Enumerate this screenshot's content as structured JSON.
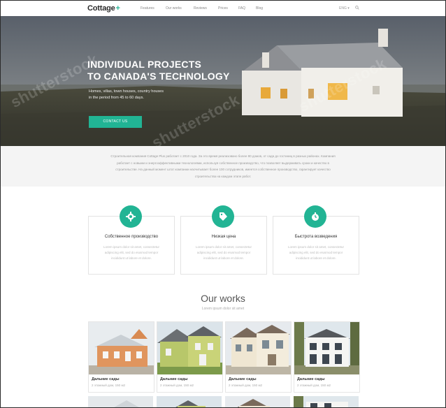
{
  "header": {
    "logo": "Cottage",
    "logo_plus": "+",
    "nav": [
      "Features",
      "Our works",
      "Reviews",
      "Prices",
      "FAQ",
      "Blog"
    ],
    "lang": "ENG ▾"
  },
  "hero": {
    "title_line1": "INDIVIDUAL PROJECTS",
    "title_line2": "TO CANADA'S TECHNOLOGY",
    "subtitle_line1": "Homes, villas, town houses, country houses",
    "subtitle_line2": "in the period from 45 to 60 days.",
    "button": "CONTACT US",
    "watermark": "shutterstock"
  },
  "about": {
    "text": "Строительная компания Cottage Plus работает с 2010 года. За это время реализовано более 80 домов, от сада до гостиниц в разных районах. Компания работает с новыми и энергоэффективными технологиями, используя собственное производство, что позволяет выдерживать сроки и качество в строительстве. На данный момент штат компании насчитывает более 100 сотрудников, имеется собственное производство, гарантирует качество строительства на каждом этапе работ."
  },
  "features": [
    {
      "title": "Собственное производство",
      "desc": "Lorem ipsum dolor sit amet, consectetur adipiscing elit, sed do eiusmod tempor incididunt ut labore et dolore."
    },
    {
      "title": "Низкая цена",
      "desc": "Lorem ipsum dolor sit amet, consectetur adipiscing elit, sed do eiusmod tempor incididunt ut labore et dolore."
    },
    {
      "title": "Быстрота возведения",
      "desc": "Lorem ipsum dolor sit amet, consectetur adipiscing elit, sed do eiusmod tempor incididunt ut labore et dolore."
    }
  ],
  "works": {
    "title": "Our works",
    "subtitle": "Lorem ipsum dolor sit amet",
    "cards": [
      {
        "name": "Дальние сады",
        "meta": "2 этажный дом, 150 м2"
      },
      {
        "name": "Дальние сады",
        "meta": "2 этажный дом, 150 м2"
      },
      {
        "name": "Дальние сады",
        "meta": "2 этажный дом, 150 м2"
      },
      {
        "name": "Дальние сады",
        "meta": "2 этажный дом, 150 м2"
      }
    ]
  },
  "colors": {
    "accent": "#21b494"
  }
}
